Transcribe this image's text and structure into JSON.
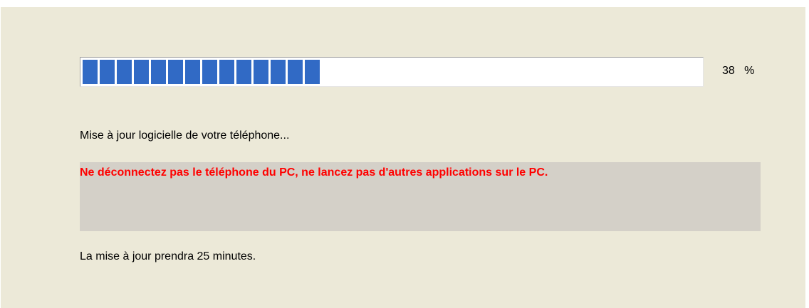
{
  "progress": {
    "percent_value": "38",
    "percent_sign": "%",
    "fraction": 0.38,
    "fill_color": "#316ac5"
  },
  "status": {
    "message": "Mise à jour logicielle de votre téléphone..."
  },
  "warning": {
    "message": "Ne déconnectez pas le téléphone du PC, ne lancez pas d'autres applications sur le PC.",
    "color": "#ff0000"
  },
  "duration": {
    "message": "La mise à jour prendra 25 minutes."
  }
}
